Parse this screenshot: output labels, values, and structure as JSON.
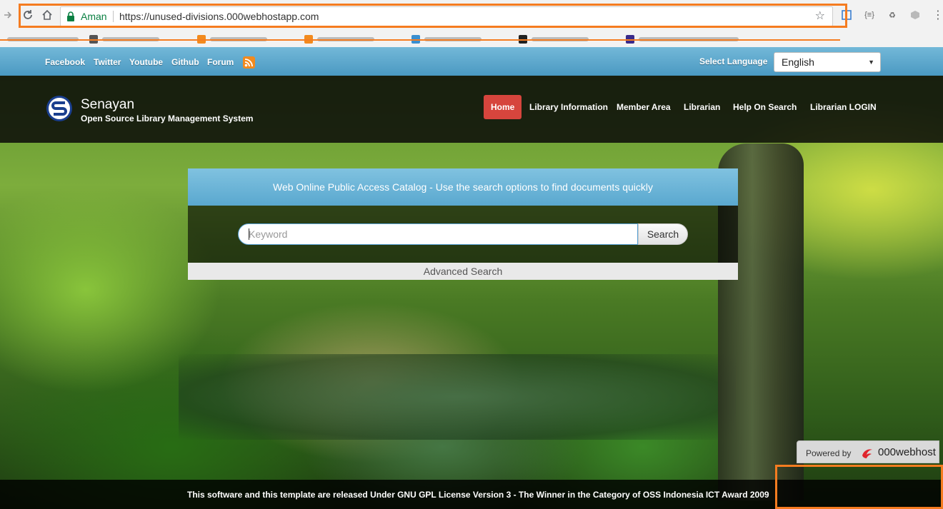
{
  "browser": {
    "secure_label": "Aman",
    "url": "https://unused-divisions.000webhostapp.com",
    "bookmark_colors": [
      "#555555",
      "#f28a1e",
      "#f28a1e",
      "#3b8fd0",
      "#222222",
      "#3a2a8a"
    ]
  },
  "topbar": {
    "links": [
      "Facebook",
      "Twitter",
      "Youtube",
      "Github",
      "Forum"
    ],
    "language_label": "Select Language",
    "language_value": "English"
  },
  "header": {
    "title": "Senayan",
    "subtitle": "Open Source Library Management System",
    "nav": [
      "Home",
      "Library Information",
      "Member Area",
      "Librarian",
      "Help On Search",
      "Librarian LOGIN"
    ],
    "active_nav": "Home"
  },
  "search": {
    "panel_title": "Web Online Public Access Catalog - Use the search options to find documents quickly",
    "placeholder": "Keyword",
    "button_label": "Search",
    "advanced_label": "Advanced Search"
  },
  "footer": {
    "text": "This software and this template are released Under GNU GPL License Version 3 - The Winner in the Category of OSS Indonesia ICT Award 2009",
    "powered_label": "Powered by",
    "host_name": "000webhost"
  },
  "colors": {
    "accent_active": "#d6453d",
    "topbar_blue": "#4a99c2",
    "highlight": "#f57c20"
  }
}
